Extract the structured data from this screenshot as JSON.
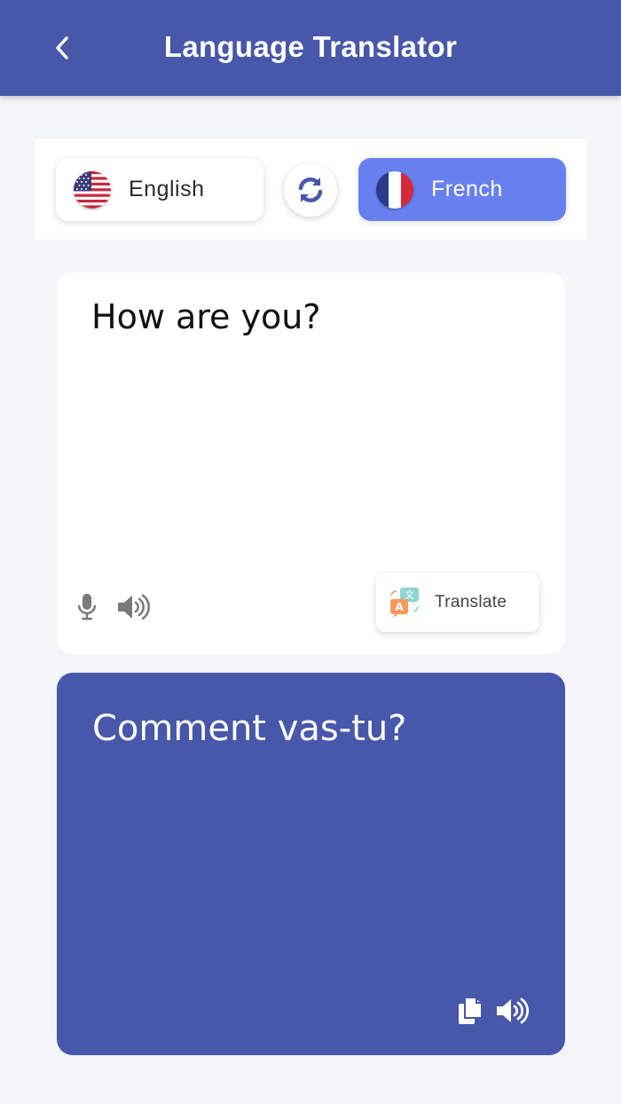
{
  "header": {
    "title": "Language Translator",
    "back_icon": "chevron-left-icon",
    "background": "#4757aa"
  },
  "languages": {
    "source": {
      "label": "English",
      "flag": "us-flag-icon"
    },
    "target": {
      "label": "French",
      "flag": "fr-flag-icon",
      "accent": "#6880ef"
    },
    "swap_icon": "swap-refresh-icon"
  },
  "input": {
    "text": "How are you?",
    "mic_icon": "microphone-icon",
    "speaker_icon": "speaker-icon",
    "translate_label": "Translate",
    "translate_icon": "translate-icon"
  },
  "output": {
    "text": "Comment vas-tu?",
    "copy_icon": "copy-icon",
    "speaker_icon": "speaker-icon",
    "background": "#4757aa"
  }
}
